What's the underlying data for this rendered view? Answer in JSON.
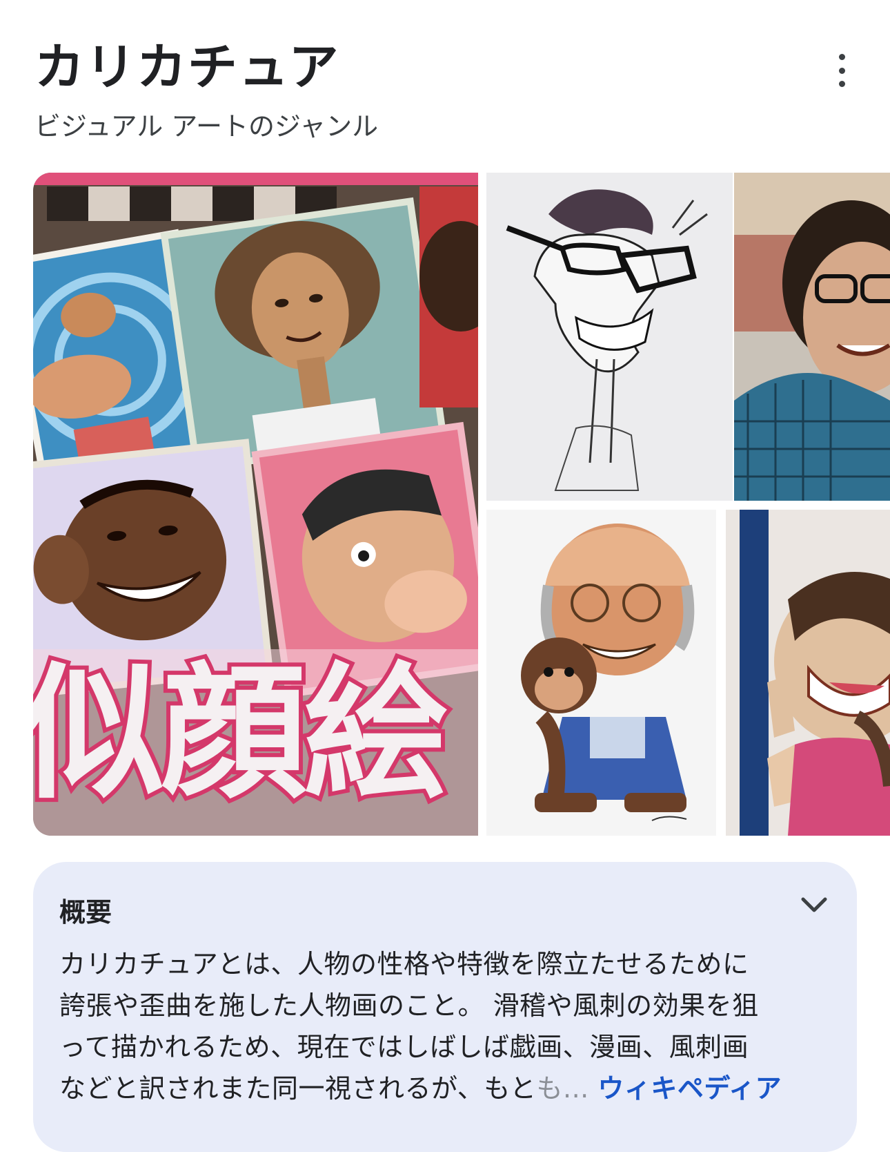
{
  "panel": {
    "title": "カリカチュア",
    "subtitle": "ビジュアル アートのジャンル",
    "more_icon": "more-vert-icon"
  },
  "gallery": {
    "main_overlay_text": "似顔絵"
  },
  "overview": {
    "heading": "概要",
    "expand_icon": "chevron-down-icon",
    "description_lines": [
      "カリカチュアとは、人物の性格や特徴を際立たせるために",
      "誇張や歪曲を施した人物画のこと。 滑稽や風刺の効果を狙",
      "って描かれるため、現在ではしばしば戯画、漫画、風刺画"
    ],
    "description_last_line": "などと訳されまた同一視されるが、もと",
    "description_faded": "も...",
    "source_link": "ウィキペディア"
  },
  "colors": {
    "link": "#1a56c8",
    "overview_bg": "#e8ecf9",
    "accent_pink": "#e0507a"
  }
}
